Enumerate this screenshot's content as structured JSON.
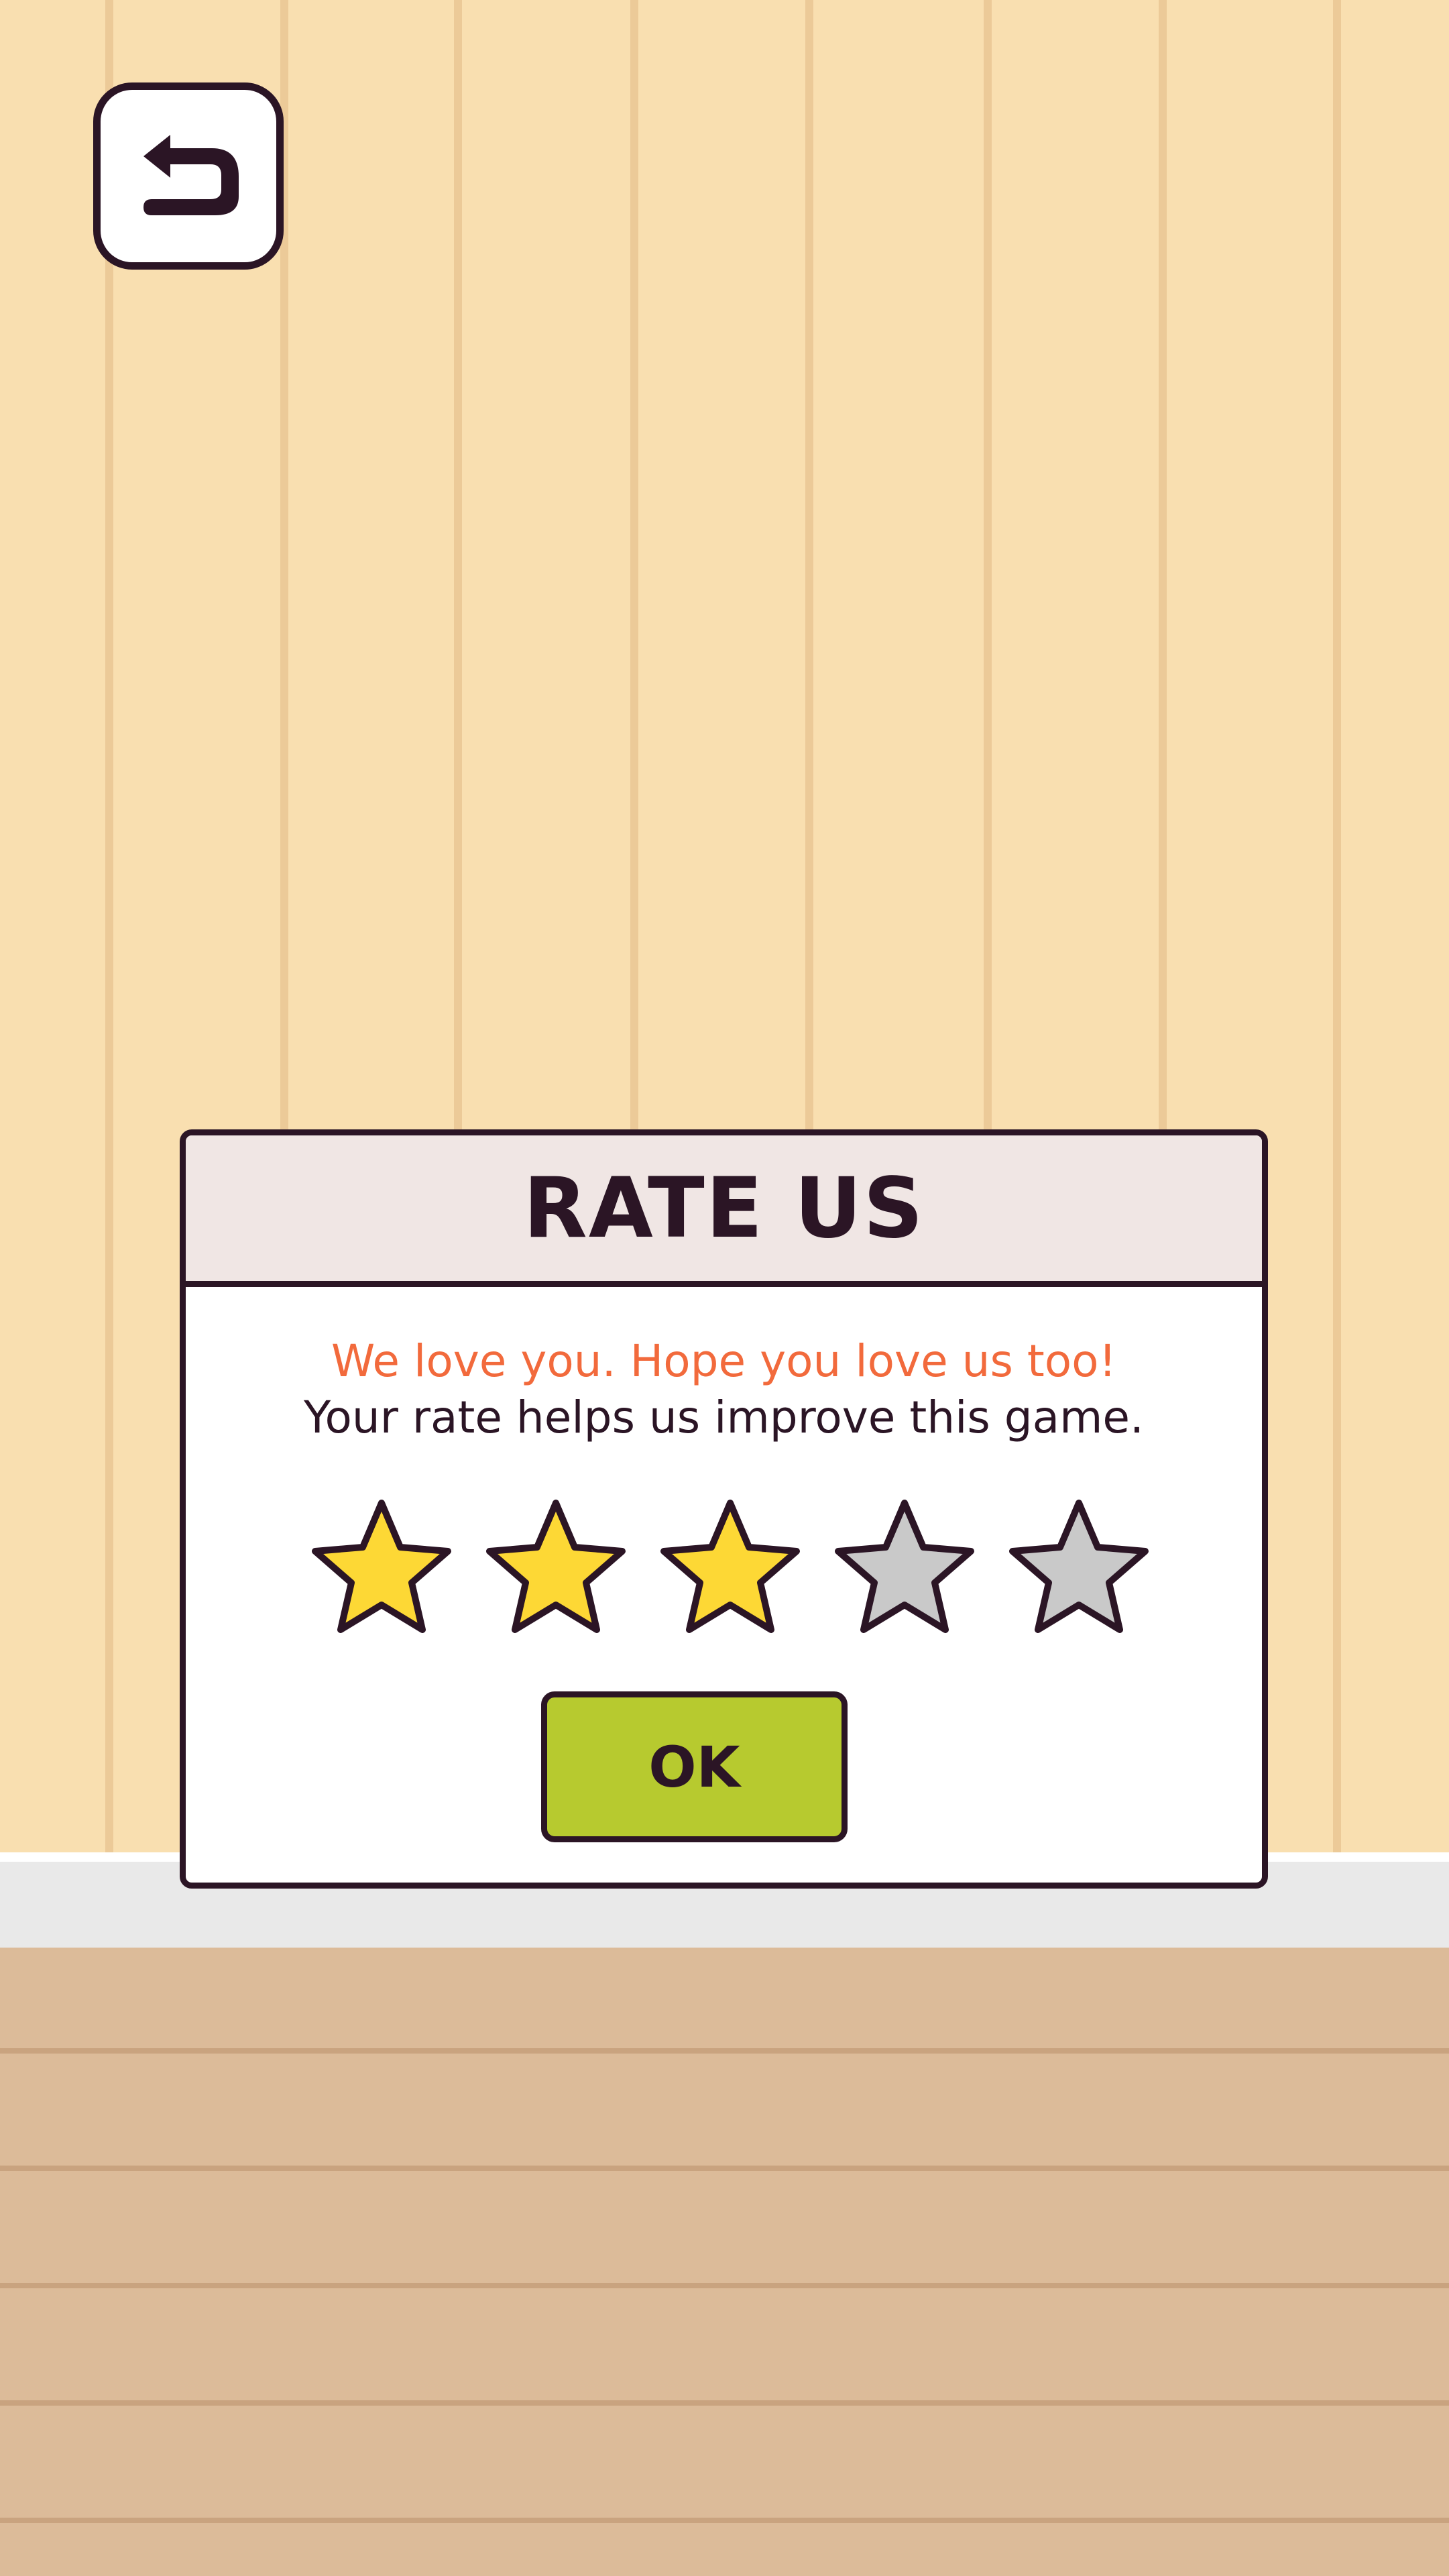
{
  "back_button": {
    "icon": "return-arrow-icon"
  },
  "dialog": {
    "title": "RATE US",
    "message_love": "We love you. Hope you love us too!",
    "message_help": "Your rate helps us improve this game.",
    "rating": {
      "value": 3,
      "max": 5,
      "filled_color": "#fdd835",
      "empty_color": "#c9c9c9"
    },
    "ok_label": "OK"
  },
  "colors": {
    "wall": "#f9dfb0",
    "floor": "#dcbb99",
    "outline": "#2b1525",
    "accent_text": "#f26a3c",
    "ok_button": "#b7ca2f"
  }
}
